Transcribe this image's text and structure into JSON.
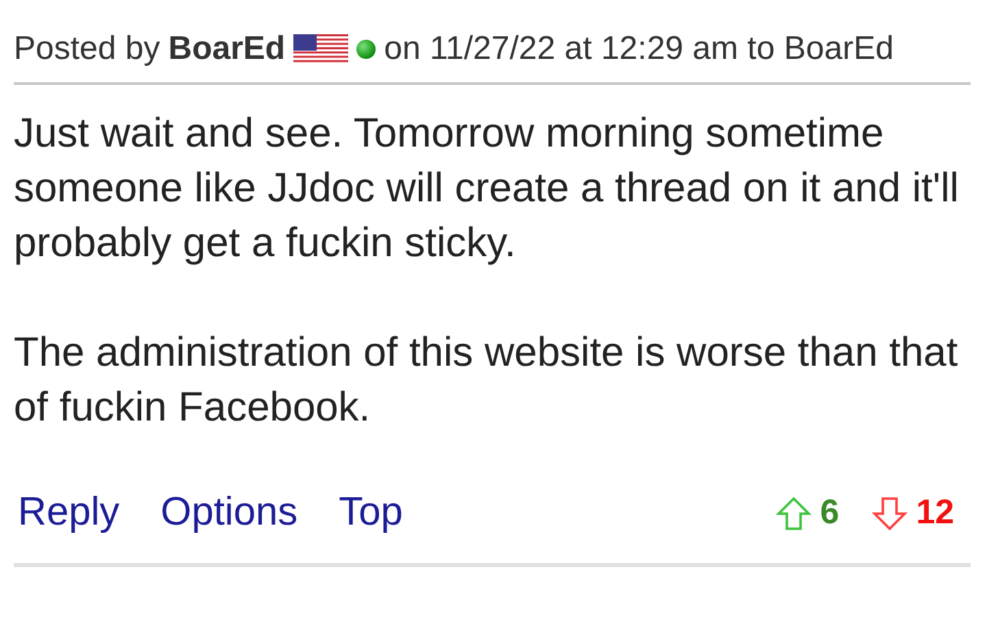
{
  "post": {
    "posted_by_label": "Posted by",
    "author": "BoarEd",
    "online": true,
    "meta": "on 11/27/22 at 12:29 am to BoarEd"
  },
  "body": [
    "Just wait and see. Tomorrow morning sometime someone like JJdoc will create a thread on it and it'll probably get a fuckin sticky.",
    "The administration of this website is worse than that of fuckin Facebook."
  ],
  "actions": [
    "Reply",
    "Options",
    "Top"
  ],
  "votes": {
    "up": "6",
    "down": "12"
  }
}
